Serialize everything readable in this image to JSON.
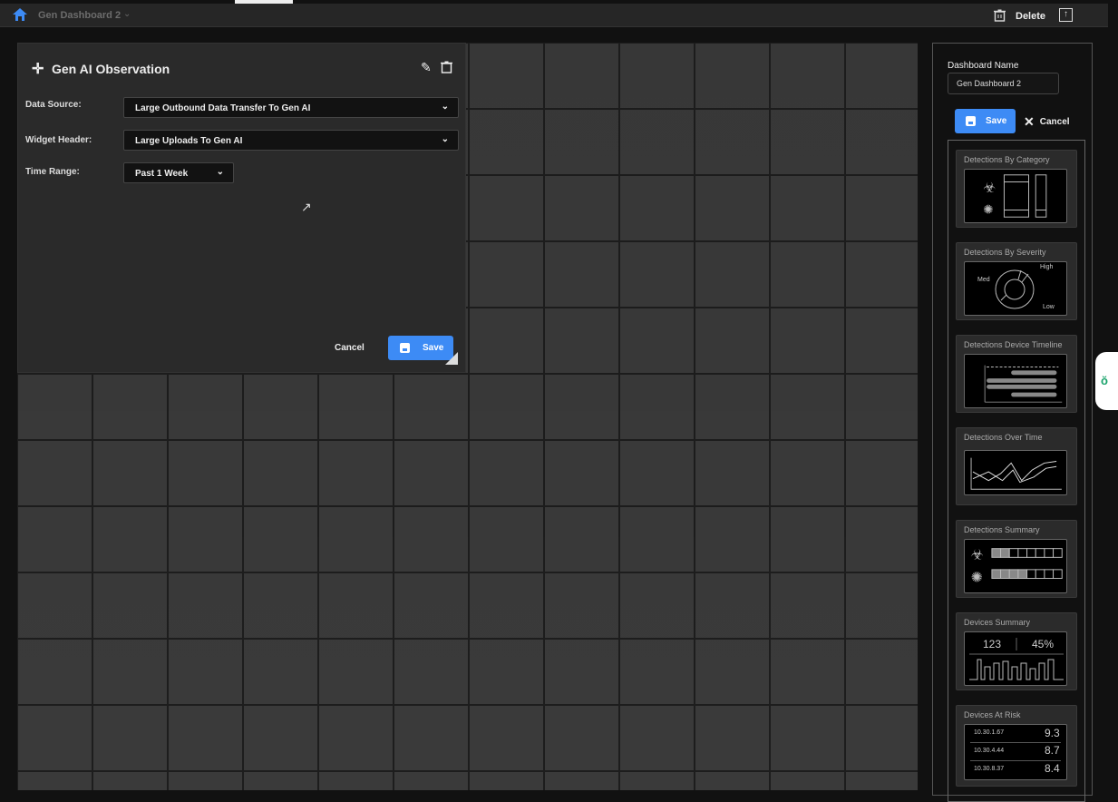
{
  "topbar": {
    "dashboard_title": "Gen Dashboard 2",
    "delete_label": "Delete"
  },
  "widget": {
    "title": "Gen AI Observation",
    "data_source_label": "Data Source:",
    "data_source_value": "Large Outbound Data Transfer To Gen AI",
    "widget_header_label": "Widget Header:",
    "widget_header_value": "Large Uploads To Gen AI",
    "time_range_label": "Time Range:",
    "time_range_value": "Past 1 Week",
    "cancel_label": "Cancel",
    "save_label": "Save"
  },
  "sidebar": {
    "name_label": "Dashboard Name",
    "name_value": "Gen Dashboard 2",
    "save_label": "Save",
    "cancel_label": "Cancel",
    "widgets": [
      {
        "title": "Detections By Category"
      },
      {
        "title": "Detections By Severity",
        "labels": {
          "high": "High",
          "med": "Med",
          "low": "Low"
        }
      },
      {
        "title": "Detections Device Timeline"
      },
      {
        "title": "Detections Over Time"
      },
      {
        "title": "Detections Summary",
        "filled": [
          2,
          4
        ]
      },
      {
        "title": "Devices Summary",
        "count": "123",
        "percent": "45%"
      },
      {
        "title": "Devices At Risk",
        "rows": [
          {
            "ip": "10.30.1.67",
            "score": "9.3"
          },
          {
            "ip": "10.30.4.44",
            "score": "8.7"
          },
          {
            "ip": "10.30.8.37",
            "score": "8.4"
          }
        ]
      }
    ]
  },
  "colors": {
    "accent": "#3d8bf5",
    "assistant": "#1aa36b"
  }
}
